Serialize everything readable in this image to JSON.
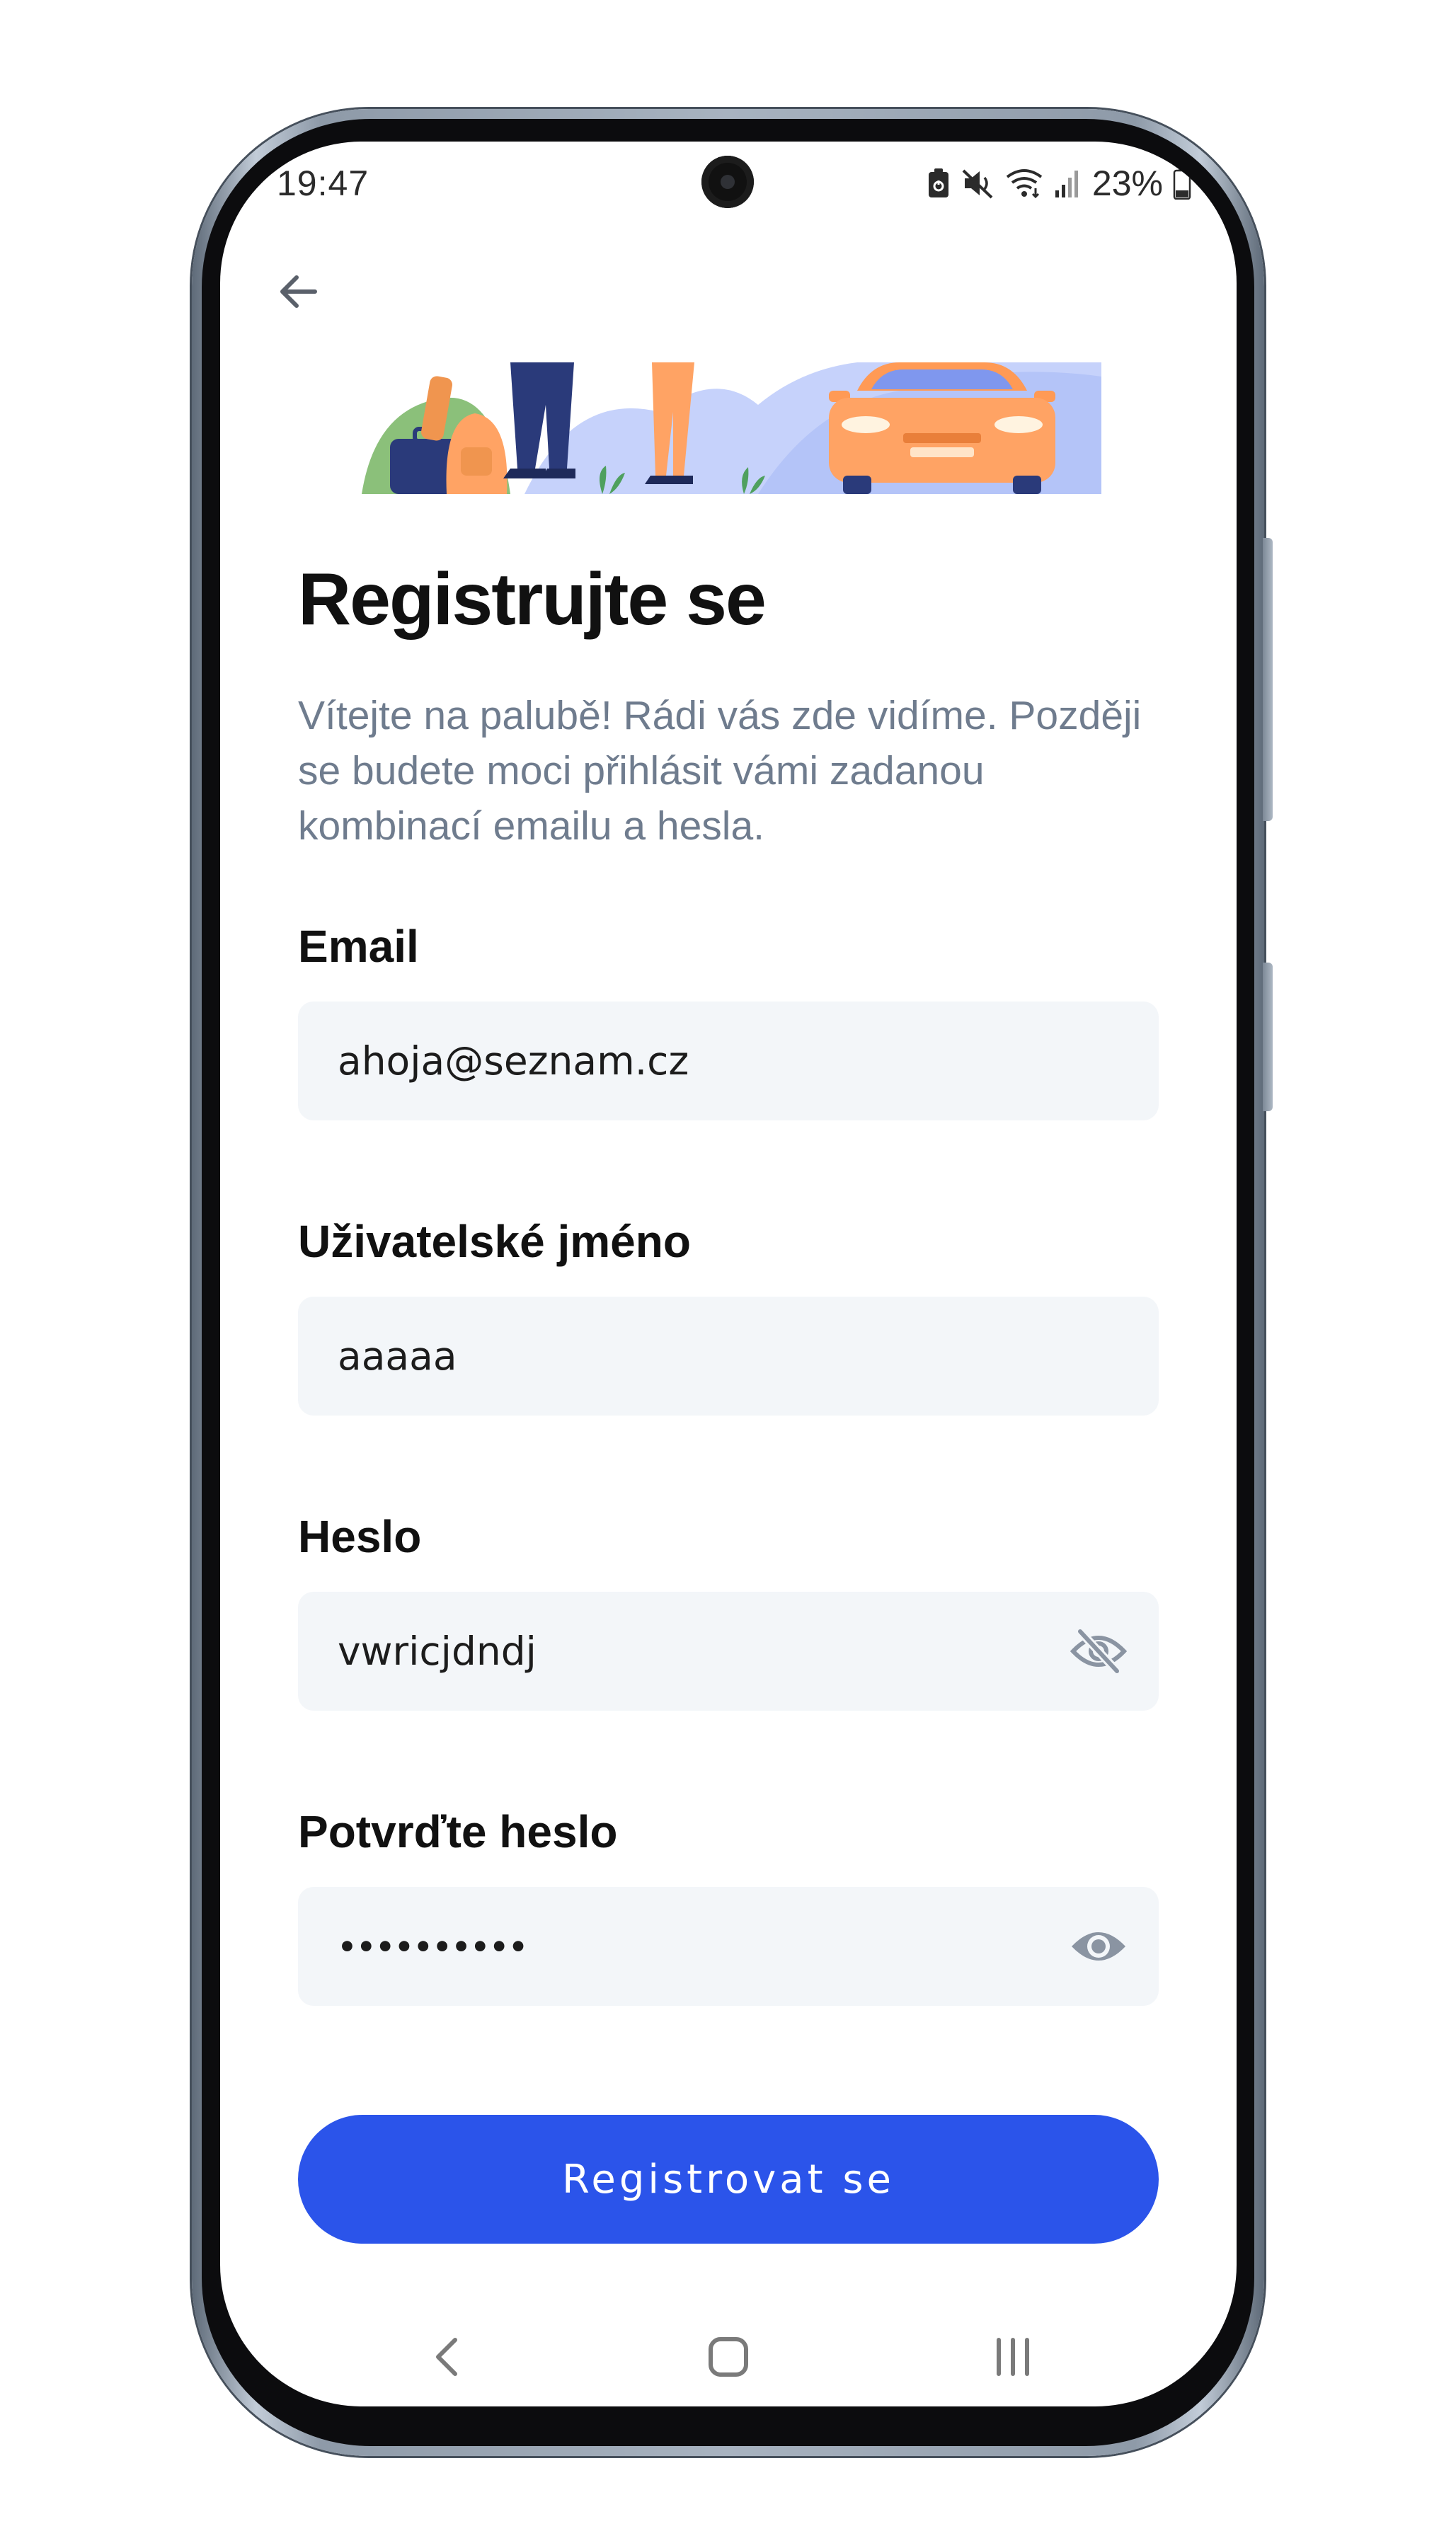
{
  "status_bar": {
    "time": "19:47",
    "battery_percent": "23%",
    "icons": [
      "battery-saver-icon",
      "mute-icon",
      "wifi-icon",
      "signal-icon",
      "battery-icon"
    ]
  },
  "header": {
    "back_icon": "arrow-left-icon"
  },
  "page": {
    "title": "Registrujte se",
    "subtitle": "Vítejte na palubě! Rádi vás zde vidíme. Později se budete moci přihlásit vámi zadanou kombinací emailu a hesla."
  },
  "form": {
    "email": {
      "label": "Email",
      "value": "ahoja@seznam.cz"
    },
    "username": {
      "label": "Uživatelské jméno",
      "value": "aaaaa"
    },
    "password": {
      "label": "Heslo",
      "value": "vwricjdndj",
      "visible": true,
      "toggle_icon": "eye-off-icon"
    },
    "confirm_password": {
      "label": "Potvrďte heslo",
      "value": "vwricjdndj",
      "visible": false,
      "toggle_icon": "eye-icon"
    },
    "submit_label": "Registrovat se"
  },
  "nav_bar": {
    "icons": [
      "nav-back-icon",
      "nav-home-icon",
      "nav-recents-icon"
    ]
  },
  "colors": {
    "primary": "#2b54ea",
    "input_bg": "#f3f6f9",
    "subtitle": "#6f7c8e",
    "illustration_blue": "#c6d2fb",
    "illustration_orange": "#ffa364",
    "illustration_navy": "#2a3a7a",
    "illustration_green": "#8bc07a"
  }
}
